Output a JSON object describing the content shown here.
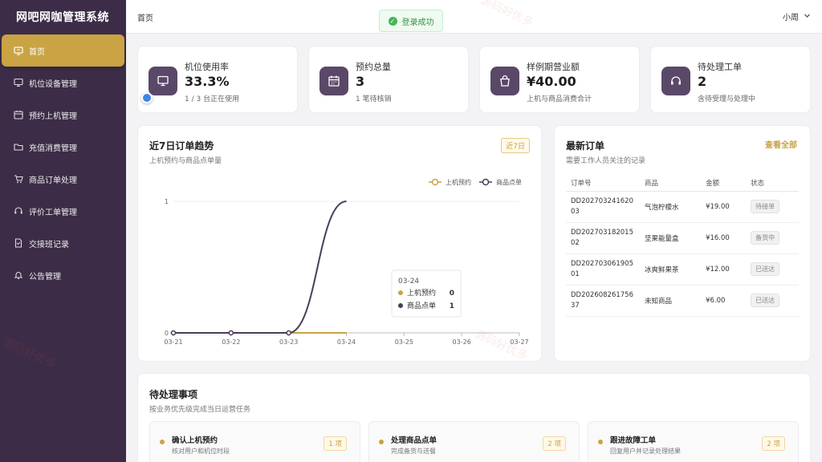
{
  "app": {
    "title": "网吧网咖管理系统"
  },
  "sidebar": {
    "items": [
      {
        "label": "首页",
        "icon": "home-icon",
        "active": true
      },
      {
        "label": "机位设备管理",
        "icon": "monitor-icon"
      },
      {
        "label": "预约上机管理",
        "icon": "calendar-icon"
      },
      {
        "label": "充值消费管理",
        "icon": "folder-icon"
      },
      {
        "label": "商品订单处理",
        "icon": "cart-icon"
      },
      {
        "label": "评价工单管理",
        "icon": "headset-icon"
      },
      {
        "label": "交接班记录",
        "icon": "document-icon"
      },
      {
        "label": "公告管理",
        "icon": "bell-icon"
      }
    ]
  },
  "header": {
    "breadcrumb": "首页",
    "user": "小周"
  },
  "toast": {
    "text": "登录成功"
  },
  "stats": [
    {
      "label": "机位使用率",
      "value": "33.3%",
      "sub": "1 / 3 台正在使用",
      "icon": "monitor-icon"
    },
    {
      "label": "预约总量",
      "value": "3",
      "sub": "1 笔待核销",
      "icon": "calendar-icon"
    },
    {
      "label": "样例期营业额",
      "value": "¥40.00",
      "sub": "上机与商品消费合计",
      "icon": "bag-icon"
    },
    {
      "label": "待处理工单",
      "value": "2",
      "sub": "含待受理与处理中",
      "icon": "headset-icon"
    }
  ],
  "trend": {
    "title": "近7日订单趋势",
    "subtitle": "上机预约与商品点单量",
    "range_badge": "近7日",
    "tooltip": {
      "date": "03-24",
      "rows": [
        {
          "name": "上机预约",
          "value": "0"
        },
        {
          "name": "商品点单",
          "value": "1"
        }
      ]
    }
  },
  "chart_data": {
    "type": "line",
    "x": [
      "03-21",
      "03-22",
      "03-23",
      "03-24",
      "03-25",
      "03-26",
      "03-27"
    ],
    "yticks": [
      "0",
      "1"
    ],
    "ylim": [
      0,
      1
    ],
    "series": [
      {
        "name": "上机预约",
        "color": "#c9a344",
        "values": [
          0,
          0,
          0,
          0
        ]
      },
      {
        "name": "商品点单",
        "color": "#4b3d5c",
        "values": [
          0,
          0,
          0,
          1
        ]
      }
    ],
    "legend": "top-right",
    "smooth": true
  },
  "orders": {
    "title": "最新订单",
    "subtitle": "需要工作人员关注的记录",
    "view_all": "查看全部",
    "columns": [
      "订单号",
      "商品",
      "金额",
      "状态"
    ],
    "rows": [
      {
        "id": "DD20270324162003",
        "item": "气泡柠檬水",
        "amount": "¥19.00",
        "status": "待接单"
      },
      {
        "id": "DD20270318201502",
        "item": "坚果能量盒",
        "amount": "¥16.00",
        "status": "备货中"
      },
      {
        "id": "DD20270306190501",
        "item": "冰爽鲜果茶",
        "amount": "¥12.00",
        "status": "已送达"
      },
      {
        "id": "DD20260826175637",
        "item": "未知商品",
        "amount": "¥6.00",
        "status": "已送达"
      }
    ]
  },
  "todo": {
    "title": "待处理事项",
    "subtitle": "按业务优先级完成当日运营任务",
    "items": [
      {
        "name": "确认上机预约",
        "desc": "核对用户和机位时段",
        "count": "1 项"
      },
      {
        "name": "处理商品点单",
        "desc": "完成备货与送餐",
        "count": "2 项"
      },
      {
        "name": "跟进故障工单",
        "desc": "回复用户并记录处理结果",
        "count": "2 项"
      }
    ]
  },
  "watermark": "源码好优多",
  "colors": {
    "sidebar": "#3d2c47",
    "accent": "#c9a344",
    "icon_bg": "#5a4868"
  }
}
